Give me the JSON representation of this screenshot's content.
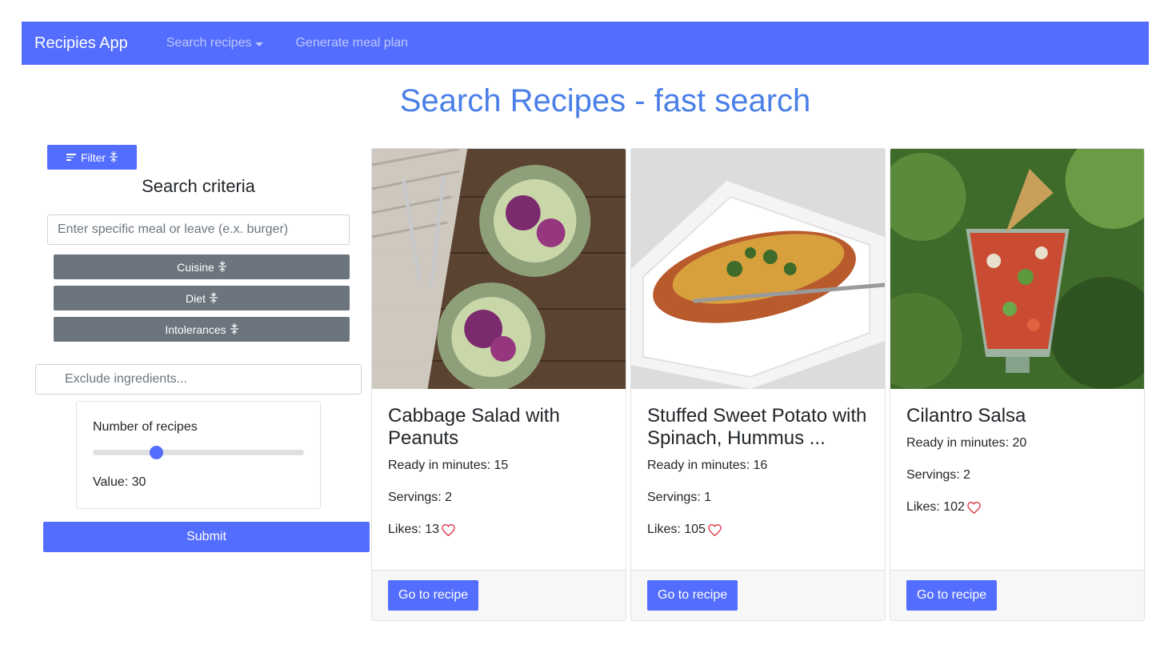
{
  "navbar": {
    "brand": "Recipies App",
    "items": [
      {
        "label": "Search recipes"
      },
      {
        "label": "Generate meal plan"
      }
    ]
  },
  "page_title": "Search Recipes - fast search",
  "sidebar": {
    "filter_label": "Filter",
    "criteria_title": "Search criteria",
    "meal_placeholder": "Enter specific meal or leave (e.x. burger)",
    "buttons": [
      {
        "label": "Cuisine"
      },
      {
        "label": "Diet"
      },
      {
        "label": "Intolerances"
      }
    ],
    "exclude_placeholder": "Exclude ingredients...",
    "slider": {
      "label": "Number of recipes",
      "value_text": "Value: 30",
      "fraction": 0.3
    },
    "submit_label": "Submit"
  },
  "recipes": [
    {
      "title": "Cabbage Salad with Peanuts",
      "ready": "Ready in minutes: 15",
      "servings": "Servings: 2",
      "likes": "Likes: 13",
      "button": "Go to recipe"
    },
    {
      "title": "Stuffed Sweet Potato with Spinach, Hummus ...",
      "ready": "Ready in minutes: 16",
      "servings": "Servings: 1",
      "likes": "Likes: 105",
      "button": "Go to recipe"
    },
    {
      "title": "Cilantro Salsa",
      "ready": "Ready in minutes: 20",
      "servings": "Servings: 2",
      "likes": "Likes: 102",
      "button": "Go to recipe"
    }
  ],
  "icons": {
    "filter": "filter-lines-icon",
    "expand": "expand-icon",
    "heart": "heart-icon",
    "caret": "caret-down-icon"
  },
  "colors": {
    "primary": "#536dfe",
    "title": "#4a7fe8",
    "secondary": "#6c757d",
    "heart": "#dc3545"
  }
}
